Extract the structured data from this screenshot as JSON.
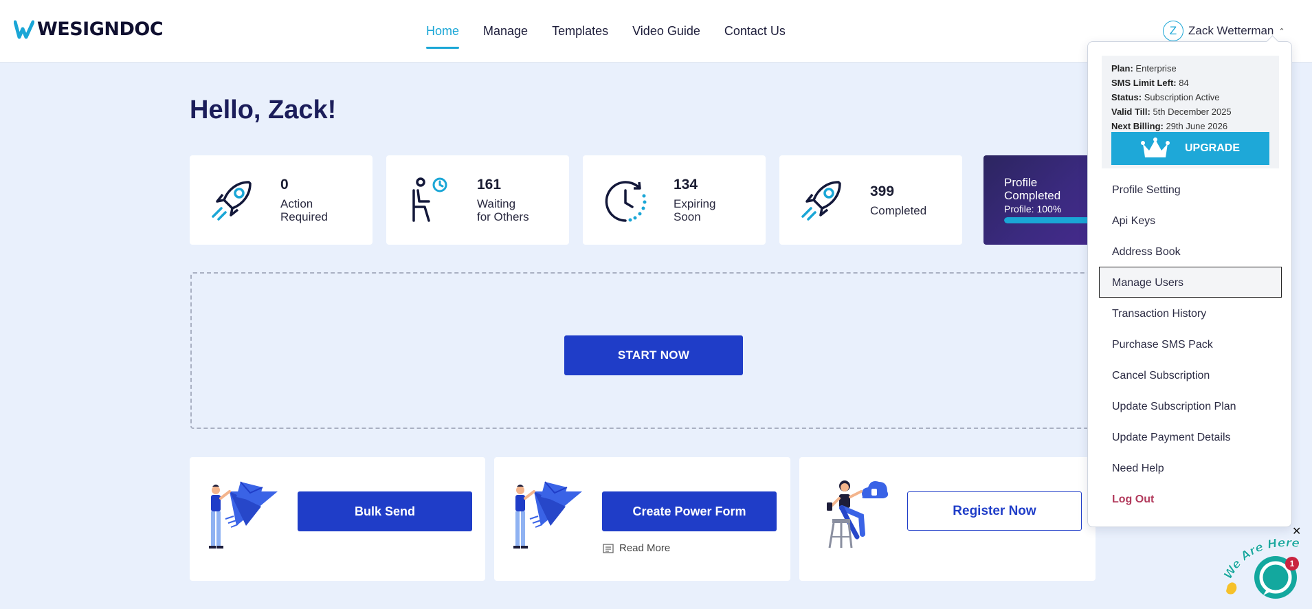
{
  "brand": {
    "name": "WESIGNDOC",
    "accent": "#1aa6d6",
    "primary": "#1f3dc8"
  },
  "nav": {
    "items": [
      {
        "label": "Home",
        "active": true
      },
      {
        "label": "Manage"
      },
      {
        "label": "Templates"
      },
      {
        "label": "Video Guide"
      },
      {
        "label": "Contact Us"
      }
    ]
  },
  "user": {
    "initial": "Z",
    "name": "Zack Wetterman"
  },
  "greeting": "Hello, Zack!",
  "stats": [
    {
      "count": "0",
      "label_line1": "Action",
      "label_line2": "Required",
      "icon": "rocket-icon"
    },
    {
      "count": "161",
      "label_line1": "Waiting",
      "label_line2": "for Others",
      "icon": "waiting-person-icon"
    },
    {
      "count": "134",
      "label_line1": "Expiring",
      "label_line2": "Soon",
      "icon": "clock-icon"
    },
    {
      "count": "399",
      "label_line1": "Completed",
      "label_line2": "",
      "icon": "rocket-icon"
    }
  ],
  "profile": {
    "title_line1": "Profile",
    "title_line2": "Completed",
    "progress_label": "Profile: 100%",
    "progress": 1.0
  },
  "start_button": "START NOW",
  "actions": {
    "bulk_send": "Bulk Send",
    "power_form": "Create Power Form",
    "read_more": "Read More",
    "register": "Register Now"
  },
  "dropdown": {
    "plan": {
      "label": "Plan:",
      "value": "Enterprise"
    },
    "sms": {
      "label": "SMS Limit Left:",
      "value": "84"
    },
    "status": {
      "label": "Status:",
      "value": "Subscription Active"
    },
    "valid": {
      "label": "Valid Till:",
      "value": "5th December 2025"
    },
    "billing": {
      "label": "Next Billing:",
      "value": "29th June 2026"
    },
    "upgrade": "UPGRADE",
    "items": [
      "Profile Setting",
      "Api Keys",
      "Address Book",
      "Manage Users",
      "Transaction History",
      "Purchase SMS Pack",
      "Cancel Subscription",
      "Update Subscription Plan",
      "Update Payment Details",
      "Need Help",
      "Log Out"
    ]
  },
  "chat": {
    "badge": "1",
    "banner": "We Are Here!"
  }
}
